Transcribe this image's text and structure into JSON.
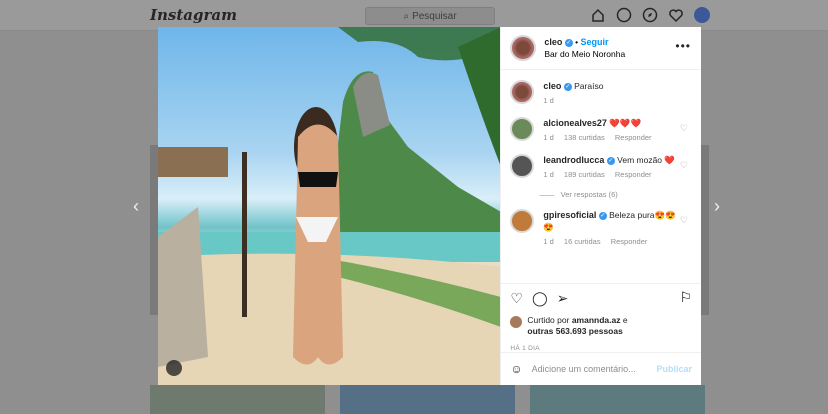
{
  "topbar": {
    "logo": "Instagram",
    "search_placeholder": "Pesquisar"
  },
  "post": {
    "username": "cleo",
    "follow_label": "Seguir",
    "location": "Bar do Meio Noronha",
    "caption": "Paraíso",
    "caption_time": "1 d",
    "comments": [
      {
        "user": "alcionealves27",
        "verified": false,
        "text": "❤️❤️❤️",
        "time": "1 d",
        "likes": "138 curtidas",
        "reply": "Responder"
      },
      {
        "user": "leandrodlucca",
        "verified": true,
        "text": "Vem mozão ❤️",
        "time": "1 d",
        "likes": "189 curtidas",
        "reply": "Responder",
        "view_replies": "Ver respostas (6)"
      },
      {
        "user": "gpiresoficial",
        "verified": true,
        "text": "Beleza pura😍😍😍",
        "time": "1 d",
        "likes": "16 curtidas",
        "reply": "Responder"
      }
    ],
    "liked_by_label": "Curtido por",
    "liked_by_user": "amannda.az",
    "liked_and": "e",
    "others": "outras 563.693 pessoas",
    "timestamp": "HÁ 1 DIA",
    "comment_placeholder": "Adicione um comentário...",
    "publish_label": "Publicar"
  },
  "colors": {
    "accent": "#0095f6",
    "verified": "#3897f0"
  }
}
